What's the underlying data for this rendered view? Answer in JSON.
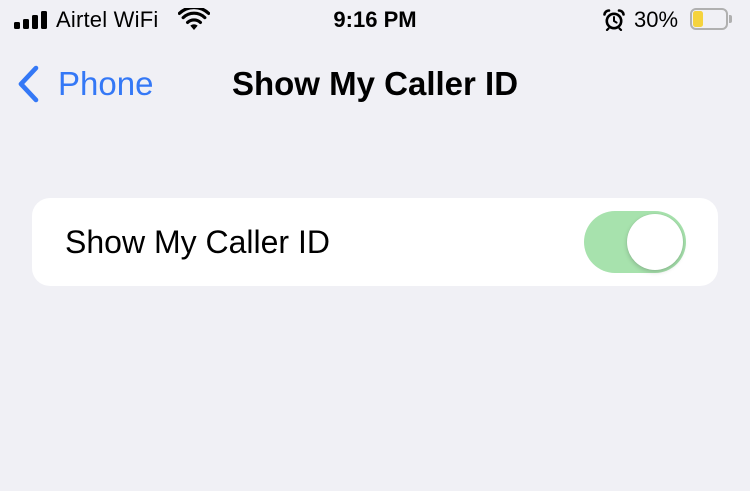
{
  "status_bar": {
    "carrier": "Airtel WiFi",
    "time": "9:16 PM",
    "battery_percent": "30%",
    "battery_level": 0.3,
    "signal_bars": 4,
    "icons": [
      "signal-icon",
      "wifi-icon",
      "alarm-icon",
      "battery-icon"
    ]
  },
  "nav": {
    "back_label": "Phone",
    "title": "Show My Caller ID"
  },
  "settings": {
    "row_label": "Show My Caller ID",
    "toggle_on": true
  },
  "colors": {
    "background": "#f0f0f5",
    "accent": "#3478f6",
    "toggle_on": "#a7e2ad",
    "battery_fill": "#f5d33d"
  }
}
